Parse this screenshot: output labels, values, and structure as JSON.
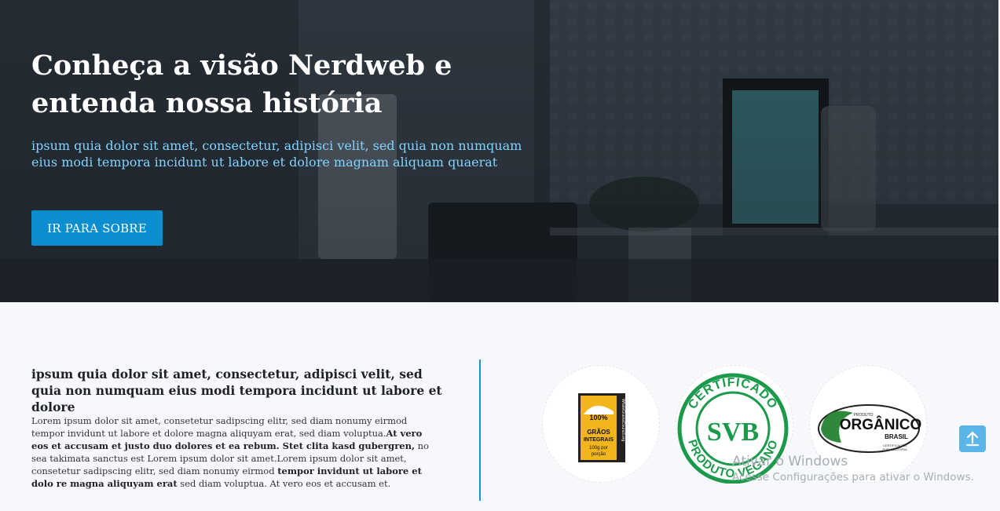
{
  "hero": {
    "title": "Conheça a visão Nerdweb e entenda nossa história",
    "subtitle": "ipsum quia dolor sit amet, consectetur, adipisci velit, sed quia non numquam eius modi tempora incidunt ut labore et dolore magnam aliquam quaerat",
    "button_label": "IR PARA SOBRE"
  },
  "about": {
    "heading": "ipsum quia dolor sit amet, consectetur, adipisci velit, sed quia non numquam eius modi tempora incidunt ut labore et dolore",
    "paragraph": {
      "p1": "Lorem ipsum dolor sit amet, consetetur sadipscing elitr, sed diam nonumy eirmod tempor invidunt ut labore et dolore magna aliquyam erat, sed diam voluptua.",
      "b1": "At vero eos et accusam et justo duo dolores et ea rebum. Stet clita kasd gubergren,",
      "p2": " no sea takimata sanctus est Lorem ipsum dolor sit amet.Lorem ipsum dolor sit amet, consetetur sadipscing elitr, sed diam nonumy eirmod ",
      "b2": "tempor invidunt ut labore et dolo re magna aliquyam erat",
      "p3": " sed diam voluptua. At vero eos et accusam et."
    }
  },
  "badges": {
    "grains": {
      "line1": "100%",
      "line2": "GRÃOS",
      "line3": "INTEGRAIS",
      "line4": "100g por",
      "line5": "porção",
      "side": "WholeGrainsCouncil.org"
    },
    "vegan": {
      "top": "CERTIFICADO",
      "bottom": "PRODUTO VEGANO",
      "center": "SVB"
    },
    "organic": {
      "small": "PRODUTO",
      "big": "ORGÂNICO",
      "country": "BRASIL",
      "foot1": "CERTIFICAÇÃO",
      "foot2": "POR AUDITORIA"
    }
  },
  "watermark": {
    "title": "Ativar o Windows",
    "subtitle": "Acesse Configurações para ativar o Windows."
  },
  "colors": {
    "accent": "#0b8ecf",
    "subtitle": "#7fd3ff",
    "divider": "#1b95cf",
    "scroll_button": "#5bb5e8"
  },
  "icons": {
    "scroll_top": "arrow-up-icon"
  }
}
